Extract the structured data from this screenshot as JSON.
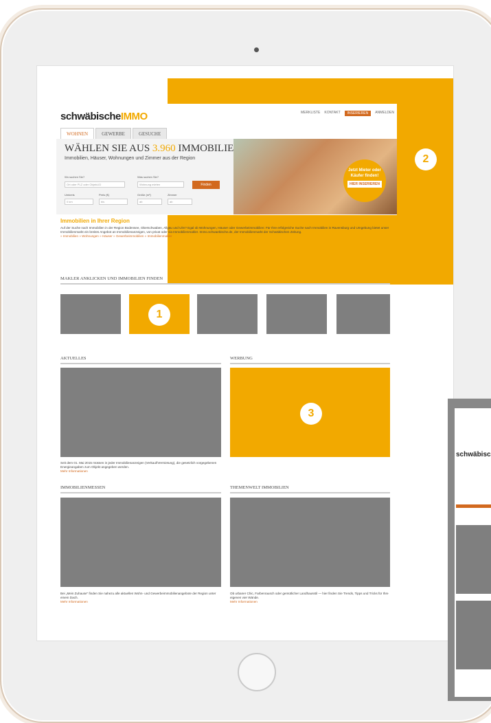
{
  "brand": {
    "logo_main": "schwäbische",
    "logo_accent": "IMMO"
  },
  "topnav": [
    "MERKLISTE",
    "KONTAKT",
    "INSERIEREN",
    "ANMELDEN"
  ],
  "tabs": [
    "WOHNEN",
    "GEWERBE",
    "GESUCHE"
  ],
  "hero": {
    "title_prefix": "WÄHLEN SIE AUS ",
    "title_count": "3.960",
    "title_suffix": " IMMOBILIEN",
    "subtitle": "Immobilien, Häuser, Wohnungen und Zimmer aus der Region",
    "where_label": "Wo suchen Sie?",
    "where_placeholder": "Ort oder PLZ oder Objekt-ID",
    "what_label": "Was suchen Sie?",
    "what_value": "Wohnung mieten",
    "find_button": "Finden",
    "radius_label": "Umkreis",
    "radius_value": "0 km",
    "price_label": "Preis (€)",
    "price_value": "bis",
    "area_label": "Größe (m²)",
    "area_value": "ab",
    "rooms_label": "Zimmer",
    "rooms_value": "ab",
    "promo_text": "Jetzt Mieter oder Käufer finden!",
    "promo_cta": "HIER INSERIEREN"
  },
  "region": {
    "title": "Immobilien in Ihrer Region",
    "text": "Auf der Suche nach Immobilien in der Region Bodensee, Oberschwaben, Allgäu und Ulm? Egal ob Wohnungen, Häuser oder Gewerbeimmobilien: Für Ihre erfolgreiche Suche nach Immobilien in Ravensburg und Umgebung bietet unser Immobilienmarkt ein breites Angebot an Immobilienanzeigen, von privat oder via Immobilienmakler. Immo.schwaebische.de, der Immobilienmarkt der Schwäbischen Zeitung.",
    "links": "» Immobilien  » Wohnungen  » Häuser  » Gewerbeimmobilien  » Immobilienmakler"
  },
  "sections": {
    "makler": "MAKLER ANKLICKEN UND IMMOBILIEN FINDEN",
    "aktuelles": "AKTUELLES",
    "werbung": "WERBUNG",
    "messen": "IMMOBILIENMESSEN",
    "themenwelt": "THEMENWELT IMMOBILIEN"
  },
  "captions": {
    "aktuelles": "Seit dem 01. Mai 2015 müssen in jeder Immobilienanzeigen (Verkauf/Vermietung), die gesetzlich vorgegebenen Energieangaben zum Objekt angegeben werden.",
    "messen": "Bei „Mein Zuhause“ finden Sie nahezu alle aktuellen Wohn- und Gewerbeimmobilienangebote der Region unter einem Dach.",
    "themenwelt": "Ob urbaner Chic, Farbenrausch oder gemütlicher Landhausstil — hier finden Sie Trends, Tipps und Tricks für Ihre eigenen vier Wände.",
    "more": "Mehr Informationen"
  },
  "badges": {
    "one": "1",
    "two": "2",
    "three": "3"
  },
  "colors": {
    "accent": "#f2a900",
    "link": "#d2691e",
    "placeholder": "#7f7f7f"
  }
}
